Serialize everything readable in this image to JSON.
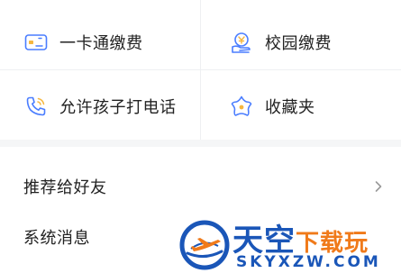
{
  "grid": {
    "tiles": [
      {
        "label": "一卡通缴费",
        "icon": "card-icon"
      },
      {
        "label": "校园缴费",
        "icon": "campus-payment-icon"
      },
      {
        "label": "允许孩子打电话",
        "icon": "phone-icon"
      },
      {
        "label": "收藏夹",
        "icon": "star-flower-icon"
      }
    ]
  },
  "list": {
    "items": [
      {
        "label": "推荐给好友",
        "chevron": "chevron-right-icon"
      },
      {
        "label": "系统消息"
      }
    ]
  },
  "watermark": {
    "brand_main": "天空",
    "brand_accent": "下载玩",
    "url": "SKYXZW.COM"
  },
  "colors": {
    "accent": "#4a7dff",
    "text": "#222222",
    "background": "#f5f6f7",
    "watermark_blue": "#1a56b8",
    "watermark_orange": "#f07a1a"
  }
}
